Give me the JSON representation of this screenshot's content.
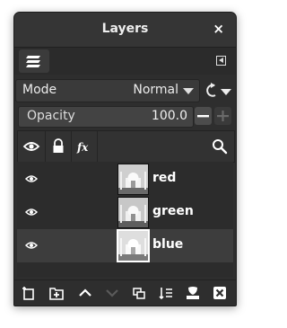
{
  "window": {
    "title": "Layers"
  },
  "mode": {
    "label": "Mode",
    "value": "Normal"
  },
  "opacity": {
    "label": "Opacity",
    "value": "100.0"
  },
  "layers": [
    {
      "name": "red",
      "visible": true,
      "selected": false
    },
    {
      "name": "green",
      "visible": true,
      "selected": false
    },
    {
      "name": "blue",
      "visible": true,
      "selected": true
    }
  ],
  "icons": {
    "close": "×",
    "tab": "layers-stack-icon",
    "header": [
      "eye-icon",
      "lock-icon",
      "fx-icon",
      "search-icon"
    ],
    "footer": [
      "new-layer-icon",
      "new-layer-group-icon",
      "raise-layer-icon",
      "lower-layer-icon",
      "duplicate-layer-icon",
      "anchor-merge-icon",
      "add-mask-icon",
      "delete-layer-icon"
    ]
  },
  "colors": {
    "panel": "#2e2e2e",
    "selected_row": "#3d3d3d",
    "text": "#ffffff"
  }
}
